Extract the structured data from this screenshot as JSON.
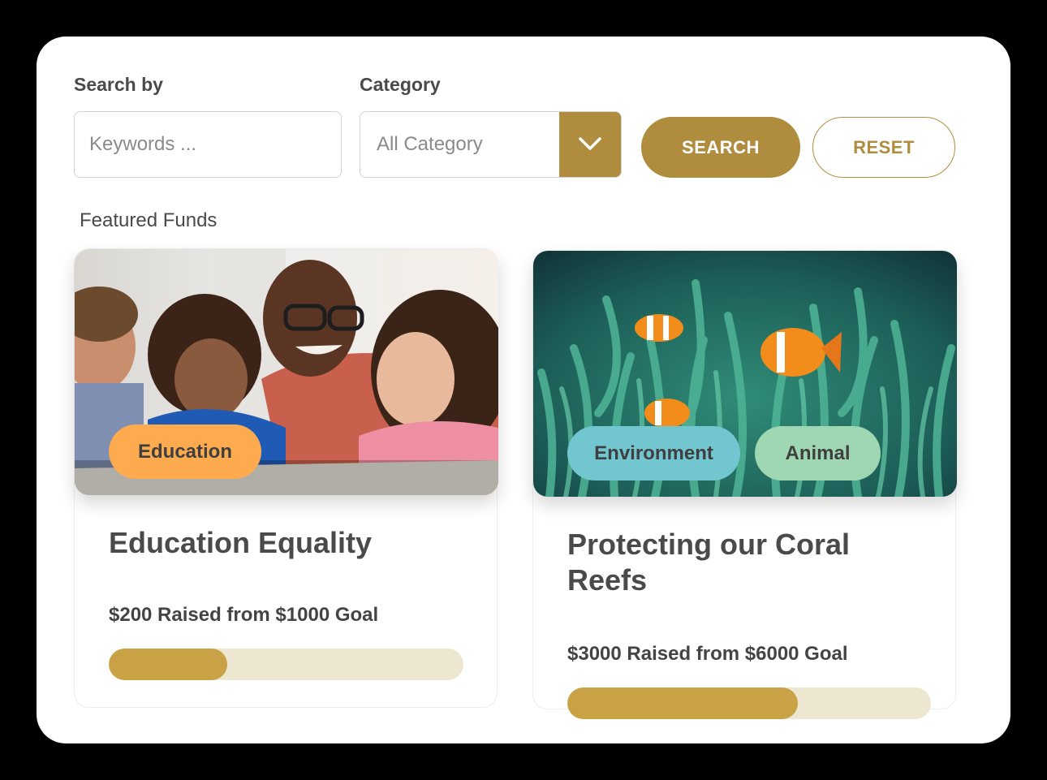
{
  "search": {
    "label": "Search by",
    "placeholder": "Keywords ..."
  },
  "category": {
    "label": "Category",
    "selected": "All Category",
    "icon": "chevron-down-icon"
  },
  "buttons": {
    "search": "SEARCH",
    "reset": "RESET"
  },
  "featured": {
    "title": "Featured Funds",
    "cards": [
      {
        "tags": [
          {
            "label": "Education",
            "color": "#fdab4e"
          }
        ],
        "image": "classroom-photo",
        "title": "Education Equality",
        "raised_text": "$200 Raised from $1000 Goal",
        "raised": 200,
        "goal": 1000,
        "progress": 0.2
      },
      {
        "tags": [
          {
            "label": "Environment",
            "color": "#72c6cf"
          },
          {
            "label": "Animal",
            "color": "#9ed7b1"
          }
        ],
        "image": "coral-reef-clownfish-photo",
        "title": "Protecting our Coral Reefs",
        "raised_text": "$3000 Raised from $6000 Goal",
        "raised": 3000,
        "goal": 6000,
        "progress": 0.5
      }
    ]
  },
  "colors": {
    "accent": "#b08d3e",
    "progress_fill": "#c9a245",
    "progress_track": "#ede6d1"
  }
}
